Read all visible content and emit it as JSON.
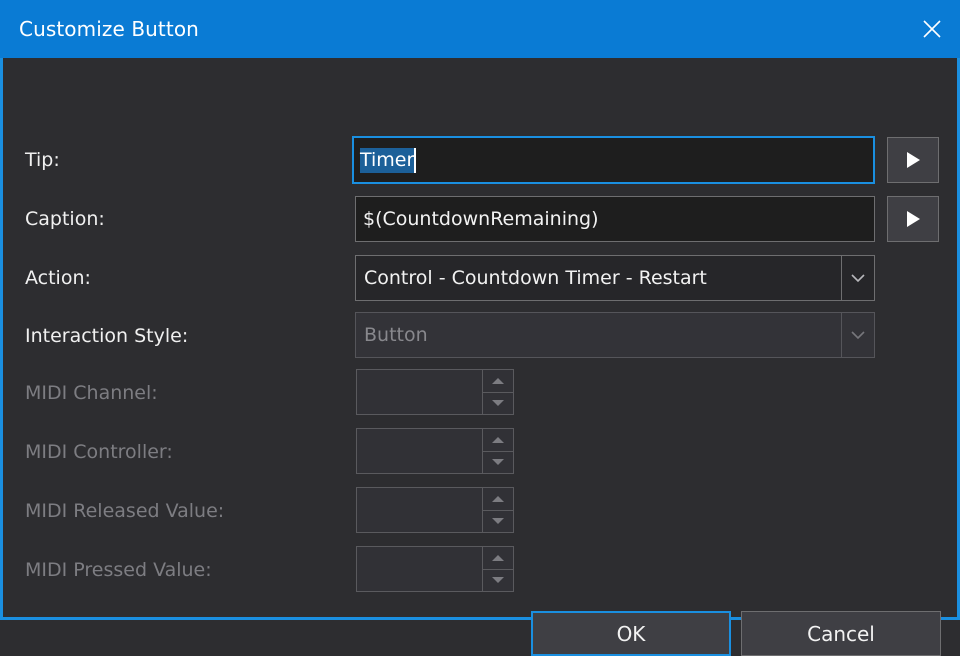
{
  "window": {
    "title": "Customize Button",
    "close_icon": "close-x-icon",
    "accent_color": "#0a7bd4",
    "border_color": "#1a8fe0",
    "background_color": "#2d2d30"
  },
  "form": {
    "rows": [
      {
        "label": "Tip:",
        "type": "text",
        "value": "Timer",
        "selected_text": "Timer",
        "focused": true,
        "disabled": false,
        "has_expand_button": true,
        "expand_icon": "play-triangle-icon"
      },
      {
        "label": "Caption:",
        "type": "text",
        "value": "$(CountdownRemaining)",
        "focused": false,
        "disabled": false,
        "has_expand_button": true,
        "expand_icon": "play-triangle-icon"
      },
      {
        "label": "Action:",
        "type": "combo",
        "value": "Control - Countdown Timer - Restart",
        "disabled": false,
        "arrow_icon": "chevron-down-icon"
      },
      {
        "label": "Interaction Style:",
        "type": "combo",
        "value": "Button",
        "disabled": true,
        "arrow_icon": "chevron-down-icon"
      },
      {
        "label": "MIDI Channel:",
        "type": "spinner",
        "value": "",
        "disabled": true,
        "up_icon": "triangle-up-icon",
        "down_icon": "triangle-down-icon"
      },
      {
        "label": "MIDI Controller:",
        "type": "spinner",
        "value": "",
        "disabled": true,
        "up_icon": "triangle-up-icon",
        "down_icon": "triangle-down-icon"
      },
      {
        "label": "MIDI Released Value:",
        "type": "spinner",
        "value": "",
        "disabled": true,
        "up_icon": "triangle-up-icon",
        "down_icon": "triangle-down-icon"
      },
      {
        "label": "MIDI Pressed Value:",
        "type": "spinner",
        "value": "",
        "disabled": true,
        "up_icon": "triangle-up-icon",
        "down_icon": "triangle-down-icon"
      }
    ]
  },
  "footer": {
    "ok_label": "OK",
    "cancel_label": "Cancel"
  }
}
